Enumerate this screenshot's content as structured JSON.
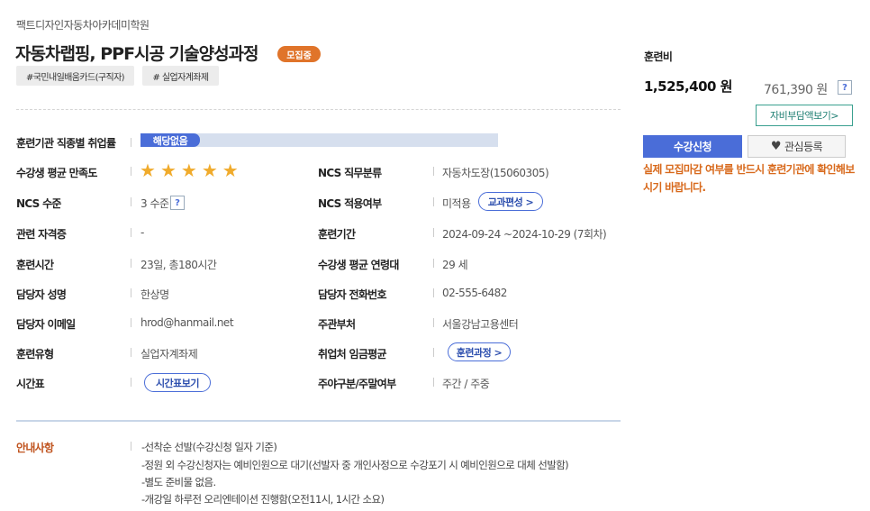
{
  "header": {
    "institute": "팩트디자인자동차아카데미학원",
    "course_title": "자동차랩핑, PPF시공 기술양성과정",
    "status_badge": "모집중",
    "tags": [
      "#국민내일배움카드(구직자)",
      "# 실업자계좌제"
    ]
  },
  "details": {
    "employment_rate_label": "훈련기관 직종별 취업률",
    "employment_rate_value": "해당없음",
    "satisfaction_label": "수강생 평균 만족도",
    "satisfaction_stars": 5,
    "ncs_level_label": "NCS 수준",
    "ncs_level_value": "3 수준",
    "ncs_level_help": "?",
    "cert_label": "관련 자격증",
    "cert_value": "-",
    "hours_label": "훈련시간",
    "hours_value": "23일, 총180시간",
    "manager_label": "담당자 성명",
    "manager_value": "한상명",
    "email_label": "담당자 이메일",
    "email_value": "hrod@hanmail.net",
    "type_label": "훈련유형",
    "type_value": "실업자계좌제",
    "timetable_label": "시간표",
    "timetable_button": "시간표보기",
    "ncs_job_label": "NCS 직무분류",
    "ncs_job_value": "자동차도장(15060305)",
    "ncs_apply_label": "NCS 적용여부",
    "ncs_apply_value": "미적용",
    "curriculum_button": "교과편성 >",
    "period_label": "훈련기간",
    "period_value": "2024-09-24 ~2024-10-29 (7회차)",
    "age_label": "수강생 평균 연령대",
    "age_value": "29 세",
    "phone_label": "담당자 전화번호",
    "phone_value": "02-555-6482",
    "org_label": "주관부처",
    "org_value": "서울강남고용센터",
    "wage_label": "취업처 임금평균",
    "course_button": "훈련과정 >",
    "day_label": "주야구분/주말여부",
    "day_value": "주간 / 주중"
  },
  "notice": {
    "label": "안내사항",
    "lines": [
      "-선착순 선발(수강신청 일자 기준)",
      "-정원 외 수강신청자는 예비인원으로 대기(선발자 중 개인사정으로 수강포기 시 예비인원으로 대체 선발함)",
      "-별도 준비물 없음.",
      "-개강일 하루전 오리엔테이션 진행함(오전11시, 1시간 소요)"
    ]
  },
  "sidebar": {
    "fee_label": "훈련비",
    "price_total": "1,525,400 원",
    "price_self": "761,390 원",
    "price_help": "?",
    "self_burden_button": "자비부담액보기>",
    "apply_button": "수강신청",
    "favorite_button": "관심등록",
    "warning": "실제 모집마감 여부를 반드시 훈련기관에 확인해보시기 바랍니다."
  },
  "colors": {
    "accent": "#4a6dd8",
    "badge": "#e0742a",
    "warning": "#d86a1d",
    "star": "#f0ab2c"
  },
  "icons": {
    "star": "star-icon",
    "heart": "heart-icon",
    "help": "question-icon"
  }
}
